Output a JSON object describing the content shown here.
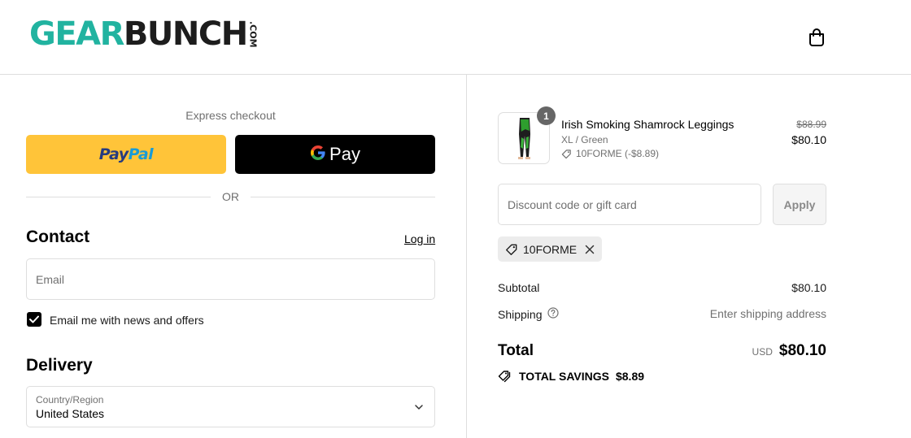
{
  "header": {
    "logo_main": "GEAR",
    "logo_second": "BUNCH",
    "logo_suffix": ".COM",
    "brand_color": "#21b3a0",
    "cart_icon": "shopping-bag-icon"
  },
  "express": {
    "title": "Express checkout",
    "paypal_label_1": "Pay",
    "paypal_label_2": "Pal",
    "gpay_g": "G",
    "gpay_label": "Pay",
    "or_text": "OR"
  },
  "contact": {
    "title": "Contact",
    "login_label": "Log in",
    "email_placeholder": "Email",
    "newsletter_label": "Email me with news and offers",
    "newsletter_checked": true
  },
  "delivery": {
    "title": "Delivery",
    "country_label": "Country/Region",
    "country_value": "United States"
  },
  "cart": {
    "item": {
      "quantity": "1",
      "name": "Irish Smoking Shamrock Leggings",
      "variant": "XL / Green",
      "discount": "10FORME (-$8.89)",
      "original_price": "$88.99",
      "price": "$80.10"
    },
    "discount_placeholder": "Discount code or gift card",
    "apply_label": "Apply",
    "applied_code": "10FORME",
    "subtotal_label": "Subtotal",
    "subtotal_value": "$80.10",
    "shipping_label": "Shipping",
    "shipping_value": "Enter shipping address",
    "total_label": "Total",
    "total_currency": "USD",
    "total_value": "$80.10",
    "savings_label": "TOTAL SAVINGS",
    "savings_value": "$8.89"
  }
}
